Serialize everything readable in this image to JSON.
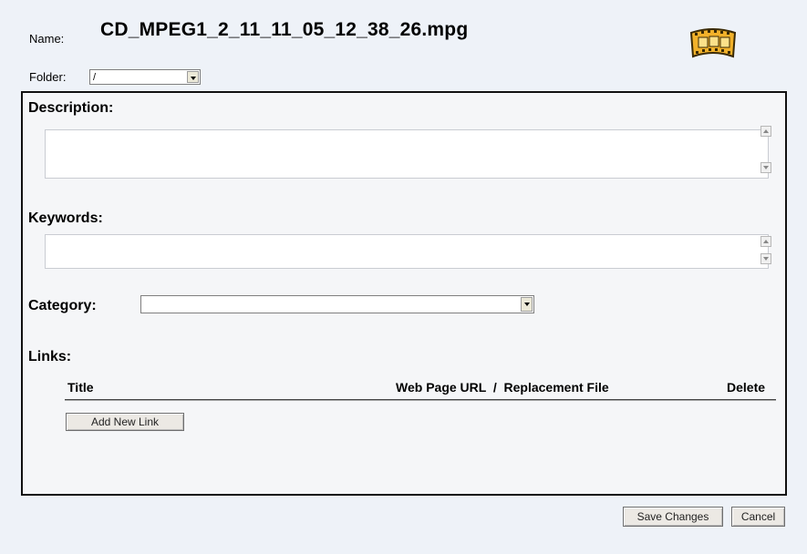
{
  "file": {
    "name_label": "Name:",
    "name_value": "CD_MPEG1_2_11_11_05_12_38_26.mpg",
    "folder_label": "Folder:",
    "folder_value": "/",
    "icon": "film-strip-icon"
  },
  "form": {
    "description_label": "Description:",
    "description_value": "",
    "keywords_label": "Keywords:",
    "keywords_value": "",
    "category_label": "Category:",
    "category_value": "",
    "links_label": "Links:",
    "links_columns": {
      "title": "Title",
      "url": "Web Page URL  /  Replacement File",
      "delete": "Delete"
    },
    "add_link_label": "Add New Link"
  },
  "actions": {
    "save_label": "Save Changes",
    "cancel_label": "Cancel"
  }
}
